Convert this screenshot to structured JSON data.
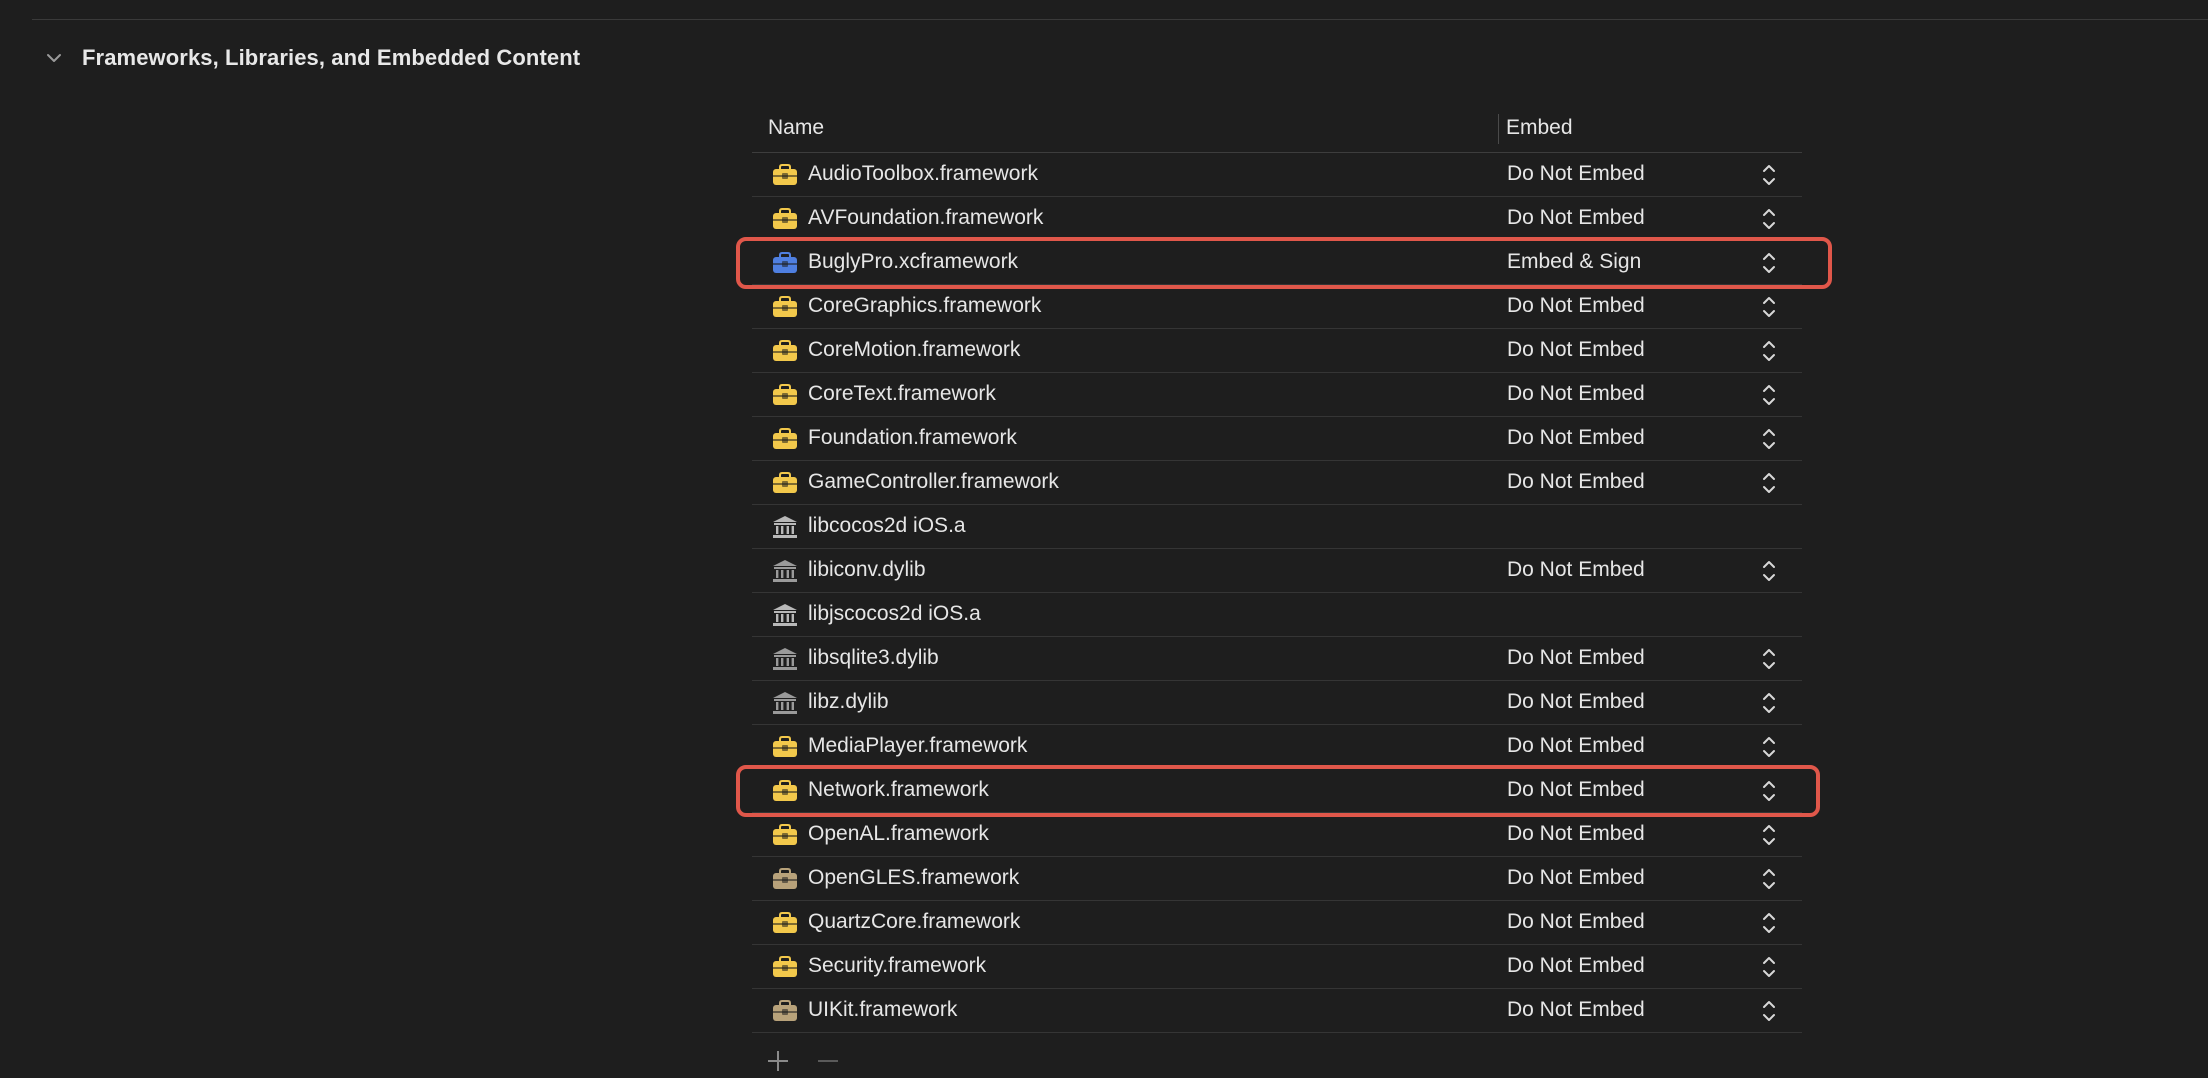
{
  "section": {
    "title": "Frameworks, Libraries, and Embedded Content",
    "disclosure_icon": "chevron-down-icon"
  },
  "table": {
    "headers": {
      "name": "Name",
      "embed": "Embed"
    },
    "rows": [
      {
        "name": "AudioToolbox.framework",
        "embed": "Do Not Embed",
        "icon": "framework-icon",
        "icon_color": "#f2c84b",
        "stepper": true
      },
      {
        "name": "AVFoundation.framework",
        "embed": "Do Not Embed",
        "icon": "framework-icon",
        "icon_color": "#f2c84b",
        "stepper": true
      },
      {
        "name": "BuglyPro.xcframework",
        "embed": "Embed & Sign",
        "icon": "xcframework-icon",
        "icon_color": "#4f7fe0",
        "stepper": true
      },
      {
        "name": "CoreGraphics.framework",
        "embed": "Do Not Embed",
        "icon": "framework-icon",
        "icon_color": "#f2c84b",
        "stepper": true
      },
      {
        "name": "CoreMotion.framework",
        "embed": "Do Not Embed",
        "icon": "framework-icon",
        "icon_color": "#f2c84b",
        "stepper": true
      },
      {
        "name": "CoreText.framework",
        "embed": "Do Not Embed",
        "icon": "framework-icon",
        "icon_color": "#f2c84b",
        "stepper": true
      },
      {
        "name": "Foundation.framework",
        "embed": "Do Not Embed",
        "icon": "framework-icon",
        "icon_color": "#f2c84b",
        "stepper": true
      },
      {
        "name": "GameController.framework",
        "embed": "Do Not Embed",
        "icon": "framework-icon",
        "icon_color": "#f2c84b",
        "stepper": true
      },
      {
        "name": "libcocos2d iOS.a",
        "embed": "",
        "icon": "library-icon",
        "icon_color": "#b8b8b8",
        "stepper": false
      },
      {
        "name": "libiconv.dylib",
        "embed": "Do Not Embed",
        "icon": "library-icon",
        "icon_color": "#9a9a9a",
        "stepper": true
      },
      {
        "name": "libjscocos2d iOS.a",
        "embed": "",
        "icon": "library-icon",
        "icon_color": "#b8b8b8",
        "stepper": false
      },
      {
        "name": "libsqlite3.dylib",
        "embed": "Do Not Embed",
        "icon": "library-icon",
        "icon_color": "#9a9a9a",
        "stepper": true
      },
      {
        "name": "libz.dylib",
        "embed": "Do Not Embed",
        "icon": "library-icon",
        "icon_color": "#9a9a9a",
        "stepper": true
      },
      {
        "name": "MediaPlayer.framework",
        "embed": "Do Not Embed",
        "icon": "framework-icon",
        "icon_color": "#f2c84b",
        "stepper": true
      },
      {
        "name": "Network.framework",
        "embed": "Do Not Embed",
        "icon": "framework-icon",
        "icon_color": "#f2c84b",
        "stepper": true
      },
      {
        "name": "OpenAL.framework",
        "embed": "Do Not Embed",
        "icon": "framework-icon",
        "icon_color": "#f2c84b",
        "stepper": true
      },
      {
        "name": "OpenGLES.framework",
        "embed": "Do Not Embed",
        "icon": "framework-icon",
        "icon_color": "#b8a27a",
        "stepper": true
      },
      {
        "name": "QuartzCore.framework",
        "embed": "Do Not Embed",
        "icon": "framework-icon",
        "icon_color": "#f2c84b",
        "stepper": true
      },
      {
        "name": "Security.framework",
        "embed": "Do Not Embed",
        "icon": "framework-icon",
        "icon_color": "#f2c84b",
        "stepper": true
      },
      {
        "name": "UIKit.framework",
        "embed": "Do Not Embed",
        "icon": "framework-icon",
        "icon_color": "#b8a27a",
        "stepper": true
      }
    ]
  },
  "highlighted_rows": [
    "BuglyPro.xcframework",
    "Network.framework"
  ],
  "highlight_color": "#e0574a",
  "footer": {
    "add_icon": "plus-icon",
    "remove_icon": "minus-icon"
  }
}
